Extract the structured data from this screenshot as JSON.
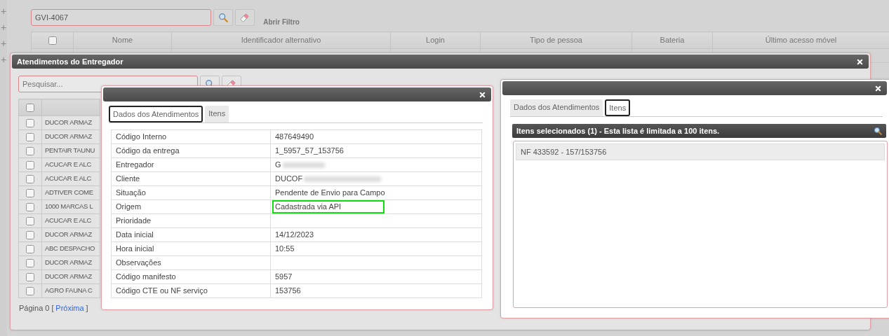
{
  "page": {
    "side_buttons": [
      "+",
      "+",
      "+",
      "+"
    ],
    "search": {
      "value": "GVI-4067"
    },
    "filter_link": "Abrir Filtro",
    "table": {
      "header_checked": false,
      "columns": [
        "Nome",
        "Identificador alternativo",
        "Login",
        "Tipo de pessoa",
        "Bateria",
        "Último acesso móvel"
      ]
    }
  },
  "deliverer_dialog": {
    "title": "Atendimentos do Entregador",
    "search": {
      "placeholder": "Pesquisar..."
    },
    "header_checked": false,
    "rows": [
      {
        "name": "DUCOR ARMAZ",
        "checked": false
      },
      {
        "name": "DUCOR ARMAZ",
        "checked": false
      },
      {
        "name": "PENTAIR TAUNU",
        "checked": false
      },
      {
        "name": "ACUCAR E ALC",
        "checked": false
      },
      {
        "name": "ACUCAR E ALC",
        "checked": false
      },
      {
        "name": "ADTIVER COME",
        "checked": false
      },
      {
        "name": "1000 MARCAS L",
        "checked": false
      },
      {
        "name": "ACUCAR E ALC",
        "checked": false
      },
      {
        "name": "DUCOR ARMAZ",
        "checked": false
      },
      {
        "name": "ABC DESPACHO",
        "checked": false
      },
      {
        "name": "DUCOR ARMAZ",
        "checked": false
      },
      {
        "name": "DUCOR ARMAZ",
        "checked": false
      },
      {
        "name": "AGRO FAUNA C",
        "checked": false
      }
    ],
    "pager": {
      "label": "Página 0 [",
      "link": "Próxima",
      "close": "]"
    }
  },
  "details_dialog": {
    "tabs": [
      {
        "label": "Dados dos Atendimentos",
        "selected": true
      },
      {
        "label": "Itens",
        "selected": false
      }
    ],
    "fields": [
      {
        "label": "Código Interno",
        "value": "487649490"
      },
      {
        "label": "Código da entrega",
        "value": "1_5957_57_153756"
      },
      {
        "label": "Entregador",
        "value": "G",
        "redacted": true
      },
      {
        "label": "Cliente",
        "value": "DUCOF",
        "redacted": true
      },
      {
        "label": "Situação",
        "value": "Pendente de Envio para Campo"
      },
      {
        "label": "Origem",
        "value": "Cadastrada via API",
        "highlighted": true
      },
      {
        "label": "Prioridade"
      },
      {
        "label": "Data inicial",
        "value": "14/12/2023"
      },
      {
        "label": "Hora inicial",
        "value": "10:55"
      },
      {
        "label": "Observações"
      },
      {
        "label": "Código manifesto",
        "value": "5957"
      },
      {
        "label": "Código CTE ou NF serviço",
        "value": "153756"
      }
    ]
  },
  "items_dialog": {
    "tabs": [
      {
        "label": "Dados dos Atendimentos",
        "selected": false
      },
      {
        "label": "Itens",
        "selected": true
      }
    ],
    "list_title": "Itens selecionados (1) - Esta lista é limitada a 100 itens.",
    "items": [
      "NF 433592 - 157/153756"
    ]
  }
}
